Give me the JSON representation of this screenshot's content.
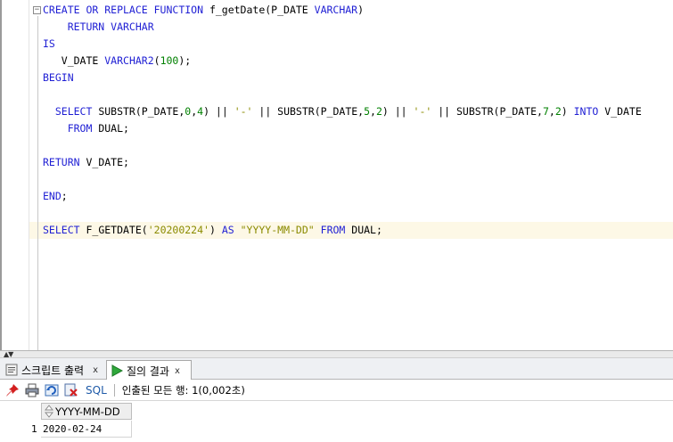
{
  "editor": {
    "lines": [
      [
        {
          "t": "CREATE OR REPLACE FUNCTION ",
          "c": "kw"
        },
        {
          "t": "f_getDate(P_DATE ",
          "c": ""
        },
        {
          "t": "VARCHAR",
          "c": "kw"
        },
        {
          "t": ")",
          "c": ""
        }
      ],
      [
        {
          "t": "    RETURN VARCHAR",
          "c": "kw"
        }
      ],
      [
        {
          "t": "IS",
          "c": "kw"
        }
      ],
      [
        {
          "t": "   V_DATE ",
          "c": ""
        },
        {
          "t": "VARCHAR2",
          "c": "kw"
        },
        {
          "t": "(",
          "c": ""
        },
        {
          "t": "100",
          "c": "num"
        },
        {
          "t": ");",
          "c": ""
        }
      ],
      [
        {
          "t": "BEGIN",
          "c": "kw"
        }
      ],
      [],
      [
        {
          "t": "  SELECT ",
          "c": "kw"
        },
        {
          "t": "SUBSTR(P_DATE,",
          "c": ""
        },
        {
          "t": "0",
          "c": "num"
        },
        {
          "t": ",",
          "c": ""
        },
        {
          "t": "4",
          "c": "num"
        },
        {
          "t": ") || ",
          "c": ""
        },
        {
          "t": "'-'",
          "c": "str"
        },
        {
          "t": " || SUBSTR(P_DATE,",
          "c": ""
        },
        {
          "t": "5",
          "c": "num"
        },
        {
          "t": ",",
          "c": ""
        },
        {
          "t": "2",
          "c": "num"
        },
        {
          "t": ") || ",
          "c": ""
        },
        {
          "t": "'-'",
          "c": "str"
        },
        {
          "t": " || SUBSTR(P_DATE,",
          "c": ""
        },
        {
          "t": "7",
          "c": "num"
        },
        {
          "t": ",",
          "c": ""
        },
        {
          "t": "2",
          "c": "num"
        },
        {
          "t": ") ",
          "c": ""
        },
        {
          "t": "INTO",
          "c": "kw"
        },
        {
          "t": " V_DATE",
          "c": ""
        }
      ],
      [
        {
          "t": "    FROM",
          "c": "kw"
        },
        {
          "t": " DUAL;",
          "c": ""
        }
      ],
      [],
      [
        {
          "t": "RETURN",
          "c": "kw"
        },
        {
          "t": " V_DATE;",
          "c": ""
        }
      ],
      [],
      [
        {
          "t": "END",
          "c": "kw"
        },
        {
          "t": ";",
          "c": ""
        }
      ],
      [],
      [
        {
          "t": "SELECT ",
          "c": "kw"
        },
        {
          "t": "F_GETDATE(",
          "c": ""
        },
        {
          "t": "'20200224'",
          "c": "str"
        },
        {
          "t": ") ",
          "c": ""
        },
        {
          "t": "AS ",
          "c": "kw"
        },
        {
          "t": "\"YYYY-MM-DD\"",
          "c": "str"
        },
        {
          "t": " ",
          "c": ""
        },
        {
          "t": "FROM",
          "c": "kw"
        },
        {
          "t": " DUAL;",
          "c": ""
        }
      ]
    ]
  },
  "tabs": [
    {
      "label": "스크립트 출력",
      "close": "x",
      "active": false
    },
    {
      "label": "질의 결과",
      "close": "x",
      "active": true
    }
  ],
  "toolbar": {
    "sql_label": "SQL",
    "status": "인출된 모든 행: 1(0,002초)"
  },
  "grid": {
    "columns": [
      "YYYY-MM-DD"
    ],
    "rows": [
      {
        "num": "1",
        "cells": [
          "2020-02-24"
        ]
      }
    ]
  }
}
